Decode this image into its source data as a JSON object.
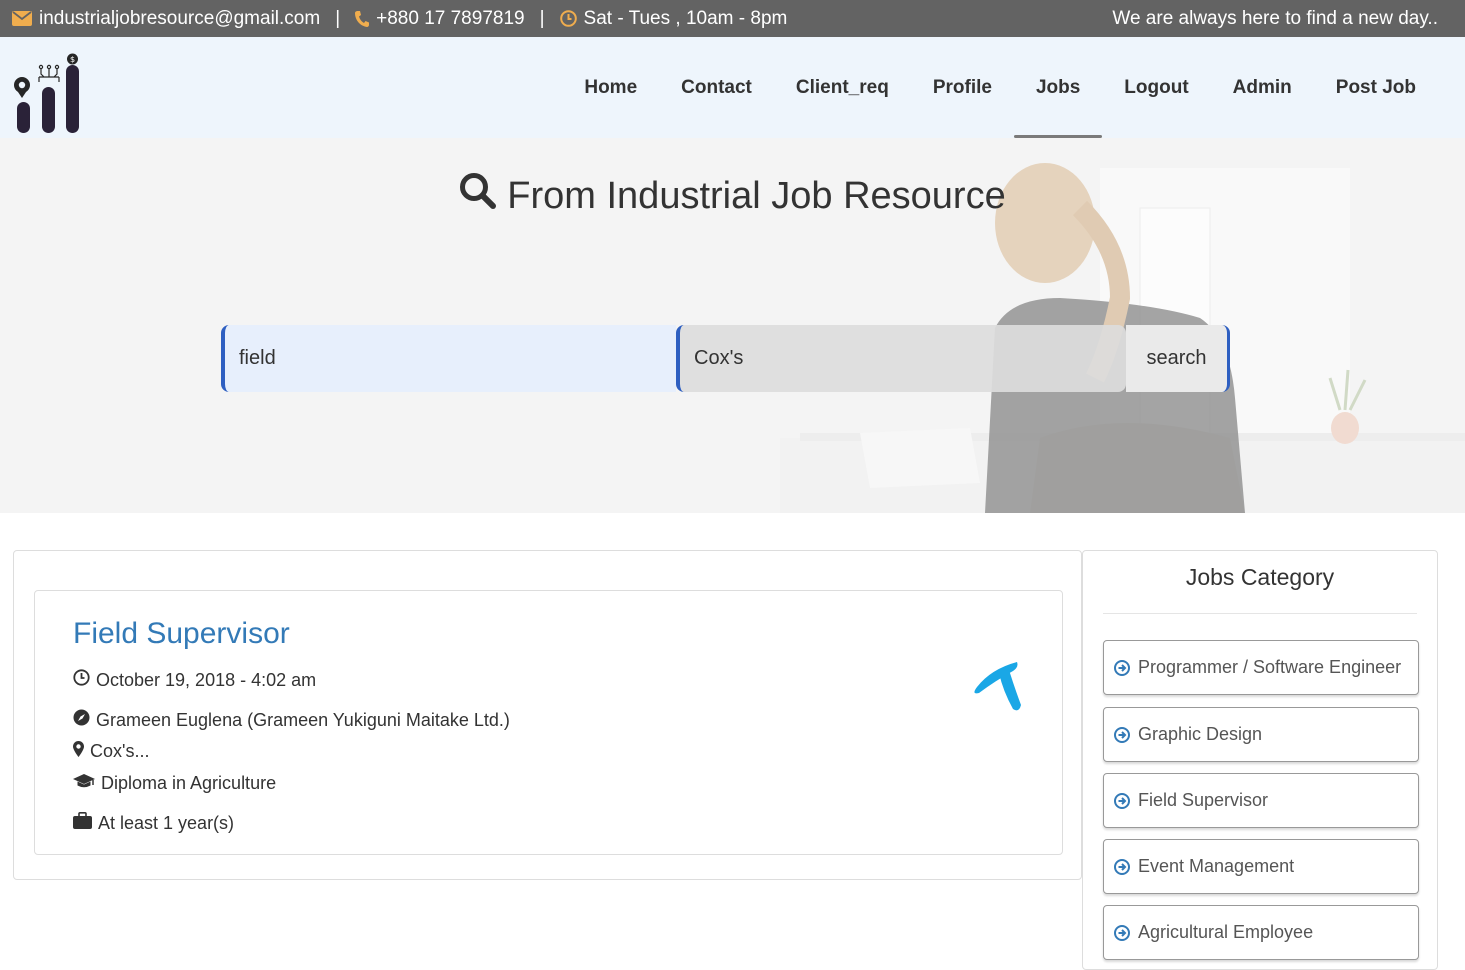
{
  "topbar": {
    "email": "industrialjobresource@gmail.com",
    "phone": "+880 17 7897819",
    "hours": "Sat - Tues , 10am - 8pm",
    "separator": "|",
    "tagline": "We are always here to find a new day..",
    "icon_color": "#f0ad4e"
  },
  "nav": {
    "items": [
      {
        "label": "Home"
      },
      {
        "label": "Contact"
      },
      {
        "label": "Client_req"
      },
      {
        "label": "Profile"
      },
      {
        "label": "Jobs",
        "active": true
      },
      {
        "label": "Logout"
      },
      {
        "label": "Admin"
      },
      {
        "label": "Post Job"
      }
    ]
  },
  "hero": {
    "title": "From Industrial Job Resource",
    "keyword_value": "field",
    "location_value": "Cox's",
    "search_label": "search"
  },
  "job": {
    "title": "Field Supervisor",
    "date": "October 19, 2018 - 4:02 am",
    "company": "Grameen Euglena (Grameen Yukiguni Maitake Ltd.)",
    "location": "Cox's...",
    "education": "Diploma in Agriculture",
    "experience": "At least 1 year(s)"
  },
  "sidebar": {
    "title": "Jobs Category",
    "categories": [
      {
        "label": "Programmer / Software Engineer"
      },
      {
        "label": "Graphic Design"
      },
      {
        "label": "Field Supervisor"
      },
      {
        "label": "Event Management"
      },
      {
        "label": "Agricultural Employee"
      }
    ]
  },
  "colors": {
    "accent": "#337ab7",
    "search_border": "#2e5fc1",
    "topbar_bg": "#636363",
    "navbar_bg": "#eef5fc"
  }
}
